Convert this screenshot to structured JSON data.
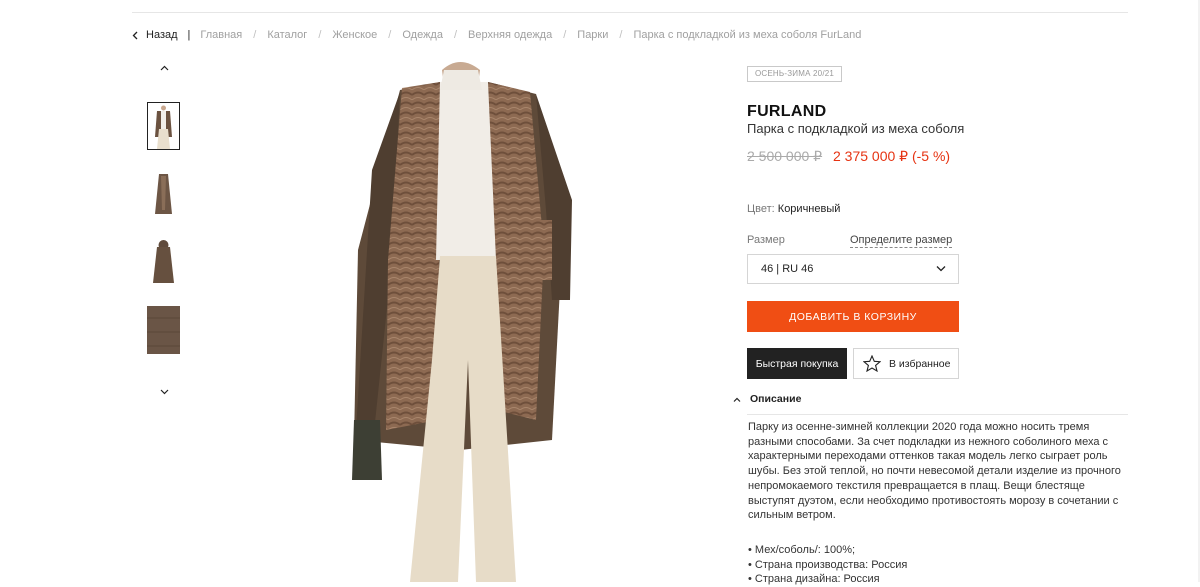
{
  "breadcrumb": {
    "back_label": "Назад",
    "divider": "|",
    "items": [
      "Главная",
      "Каталог",
      "Женское",
      "Одежда",
      "Верхняя одежда",
      "Парки",
      "Парка с подкладкой из меха соболя FurLand"
    ]
  },
  "product": {
    "season_badge": "ОСЕНЬ-ЗИМА 20/21",
    "brand": "FURLAND",
    "name": "Парка с подкладкой из меха соболя",
    "old_price": "2 500 000 ₽",
    "new_price": "2 375 000 ₽ (-5 %)",
    "color_label": "Цвет:",
    "color_value": "Коричневый",
    "size_label": "Размер",
    "size_help": "Определите размер",
    "size_selected": "46 | RU 46",
    "add_to_cart": "ДОБАВИТЬ В КОРЗИНУ",
    "quick_buy": "Быстрая покупка",
    "favorite": "В избранное"
  },
  "description": {
    "title": "Описание",
    "text": "Парку из осенне-зимней коллекции 2020 года можно носить тремя разными способами. За счет подкладки из нежного соболиного меха с характерными переходами оттенков такая модель легко сыграет роль шубы. Без этой теплой, но почти невесомой детали изделие из прочного непромокаемого текстиля превращается в плащ. Вещи блестяще выступят дуэтом, если необходимо противостоять морозу в сочетании с сильным ветром.",
    "specs": [
      "Мех/соболь/: 100%;",
      "Страна производства: Россия",
      "Страна дизайна: Россия"
    ]
  },
  "colors": {
    "accent": "#f04e14",
    "sale_price": "#e63312",
    "dark_button": "#222222"
  }
}
